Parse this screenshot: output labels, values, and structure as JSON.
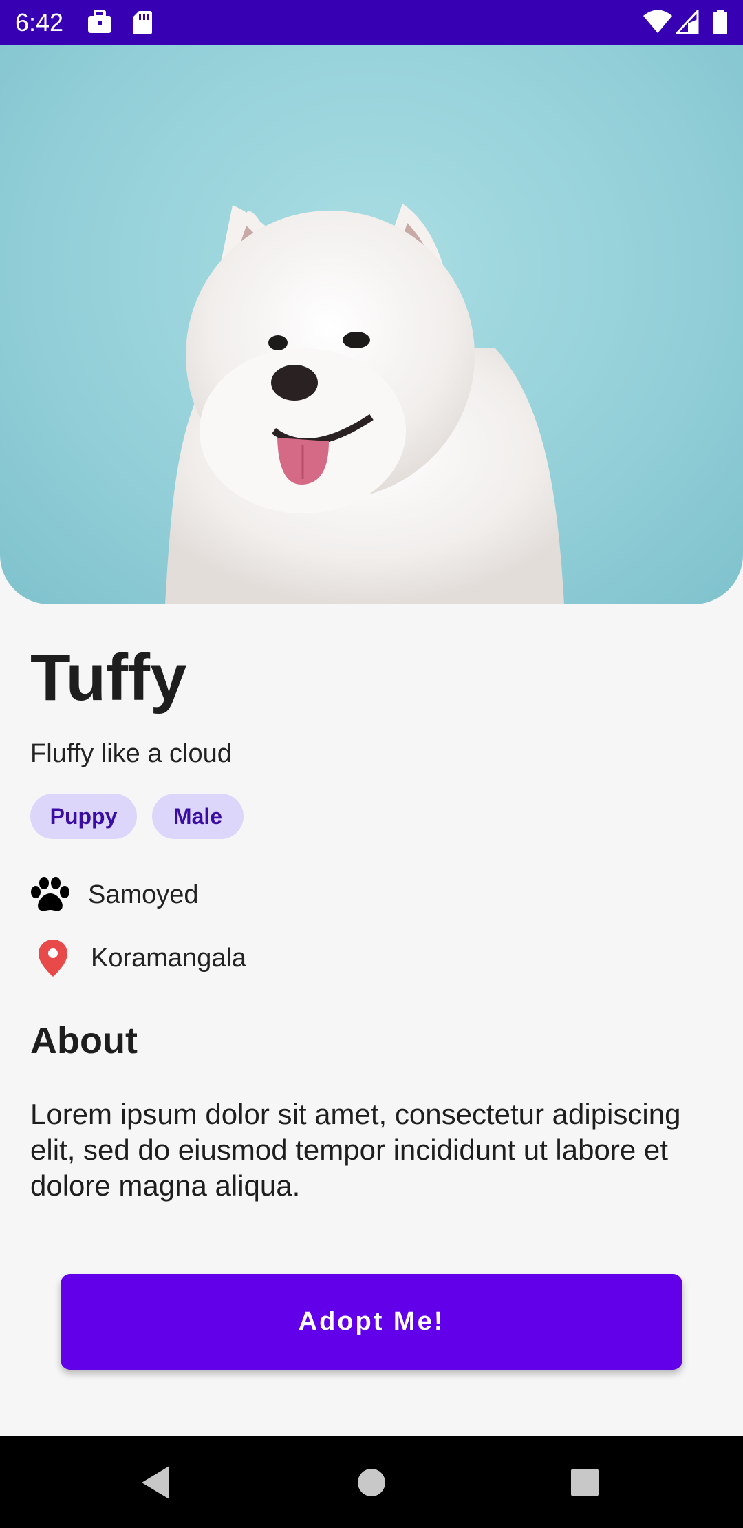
{
  "status_bar": {
    "time": "6:42",
    "left_icons": [
      "briefcase-icon",
      "sd-card-icon"
    ],
    "right_icons": [
      "wifi-icon",
      "signal-icon",
      "battery-icon"
    ],
    "background": "#3700b3"
  },
  "hero": {
    "image_description_icon": "dog-photo"
  },
  "pet": {
    "name": "Tuffy",
    "tagline": "Fluffy like a cloud",
    "tags": [
      "Puppy",
      "Male"
    ],
    "breed": "Samoyed",
    "location": "Koramangala"
  },
  "about": {
    "heading": "About",
    "body": "Lorem ipsum dolor sit amet, consectetur adipiscing elit, sed do eiusmod tempor incididunt ut labore et dolore magna aliqua."
  },
  "action": {
    "adopt_label": "Adopt Me!"
  },
  "colors": {
    "primary": "#6200ea",
    "chip_bg": "#dcd6fb",
    "chip_text": "#3a0ca3",
    "location_pin": "#e84a4a",
    "page_bg": "#f6f6f6"
  },
  "nav_bar": {
    "buttons": [
      "back-icon",
      "home-icon",
      "recents-icon"
    ]
  }
}
